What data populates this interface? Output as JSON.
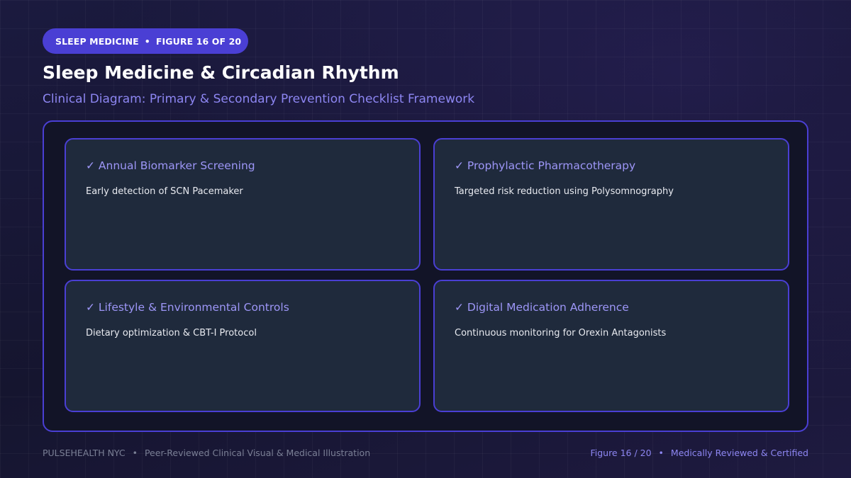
{
  "badge": {
    "section": "SLEEP MEDICINE",
    "separator": "•",
    "figure": "FIGURE 16 OF 20"
  },
  "title": "Sleep Medicine & Circadian Rhythm",
  "subtitle": "Clinical Diagram: Primary & Secondary Prevention Checklist Framework",
  "cards": [
    {
      "title": "✓ Annual Biomarker Screening",
      "description": "Early detection of SCN Pacemaker"
    },
    {
      "title": "✓ Prophylactic Pharmacotherapy",
      "description": "Targeted risk reduction using Polysomnography"
    },
    {
      "title": "✓ Lifestyle & Environmental Controls",
      "description": "Dietary optimization & CBT-I Protocol"
    },
    {
      "title": "✓ Digital Medication Adherence",
      "description": "Continuous monitoring for Orexin Antagonists"
    }
  ],
  "footer": {
    "brand": "PULSEHEALTH NYC",
    "separator": "•",
    "tagline": "Peer-Reviewed Clinical Visual & Medical Illustration",
    "figure": "Figure 16 / 20",
    "certification": "Medically Reviewed & Certified"
  },
  "colors": {
    "accent": "#4a3fd4",
    "accent_text": "#8d86f2",
    "card_bg": "#1f2a3c",
    "page_bg": "#1a1838"
  }
}
